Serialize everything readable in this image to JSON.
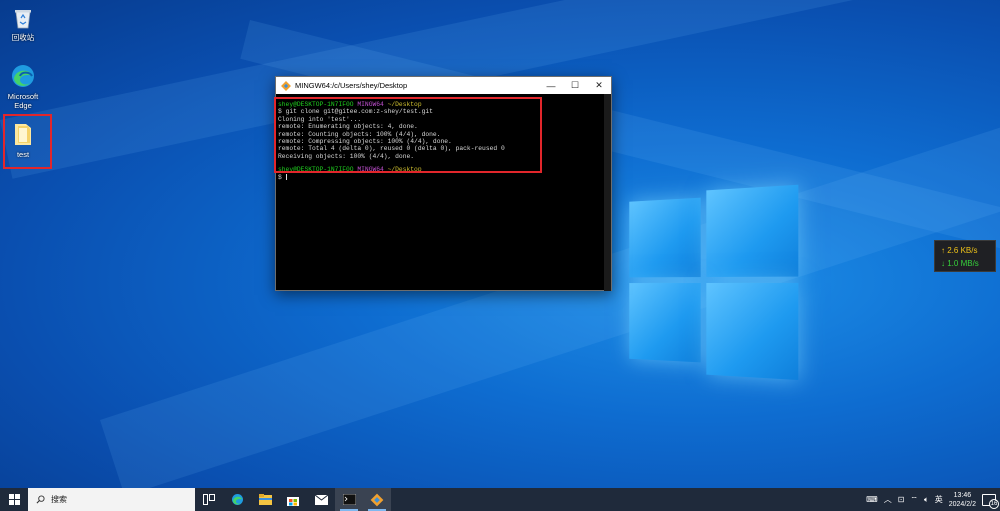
{
  "desktop": {
    "icons": [
      {
        "label": "回收站",
        "icon": "recycle-bin-icon"
      },
      {
        "label": "Microsoft Edge",
        "icon": "edge-icon"
      },
      {
        "label": "test",
        "icon": "folder-icon"
      }
    ]
  },
  "terminal": {
    "title": "MINGW64:/c/Users/shey/Desktop",
    "prompt_user": "shey@DESKTOP-1N7IF0O",
    "prompt_env": "MINGW64",
    "prompt_path": "~/Desktop",
    "prompt_symbol": "$",
    "command": "git clone git@gitee.com:z-shey/test.git",
    "output": [
      "Cloning into 'test'...",
      "remote: Enumerating objects: 4, done.",
      "remote: Counting objects: 100% (4/4), done.",
      "remote: Compressing objects: 100% (4/4), done.",
      "remote: Total 4 (delta 0), reused 0 (delta 0), pack-reused 0",
      "Receiving objects: 100% (4/4), done."
    ],
    "highlight_color": "#e2262b"
  },
  "net_widget": {
    "upload": "↑ 2.6 KB/s",
    "download": "↓ 1.0 MB/s"
  },
  "taskbar": {
    "search_placeholder": "搜索",
    "apps": [
      "task-view-icon",
      "edge-icon",
      "file-explorer-icon",
      "store-icon",
      "mail-icon",
      "terminal-icon",
      "git-icon"
    ],
    "tray": {
      "ime": "英",
      "time": "13:46",
      "date": "2024/2/2",
      "notifications": "16"
    }
  }
}
